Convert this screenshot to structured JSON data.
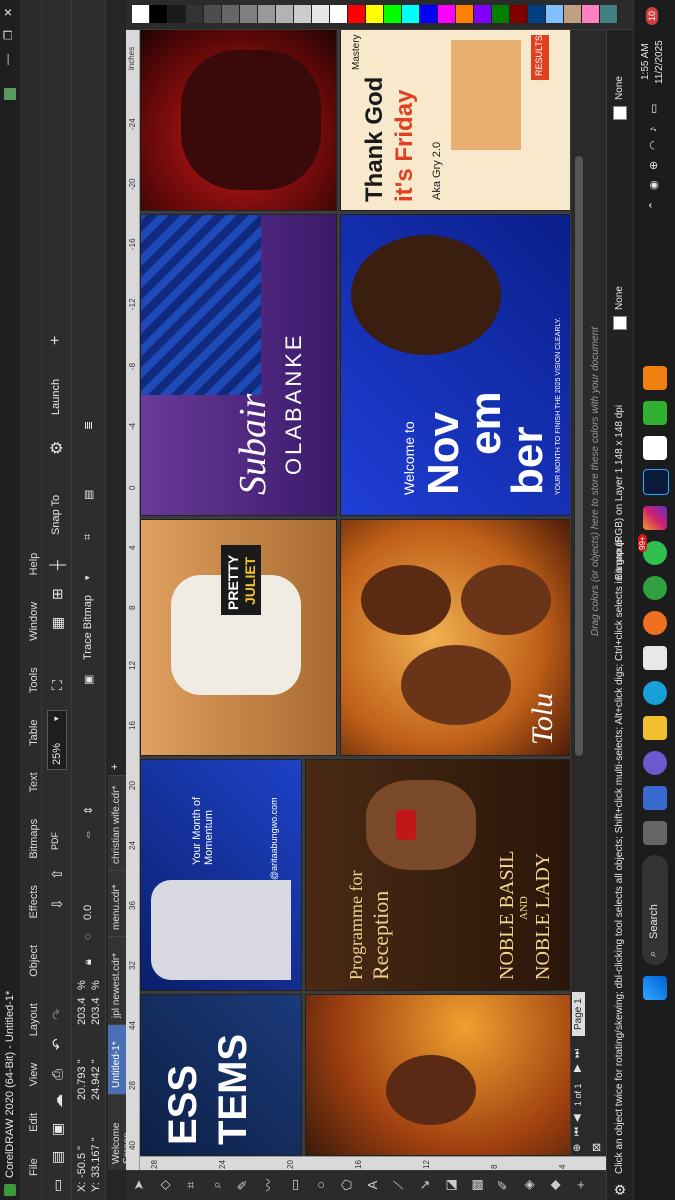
{
  "window": {
    "title": "CorelDRAW 2020 (64-Bit) - Untitled-1*"
  },
  "menu": [
    "File",
    "Edit",
    "View",
    "Layout",
    "Object",
    "Effects",
    "Bitmaps",
    "Text",
    "Table",
    "Tools",
    "Window",
    "Help"
  ],
  "toolbar": {
    "zoom": "25%",
    "snap_to": "Snap To",
    "launch": "Launch"
  },
  "properties": {
    "x": "-50.5 \"",
    "y": "33.167 \"",
    "w": "20.793 \"",
    "h": "24.942 \"",
    "sx": "203.4",
    "sy": "203.4",
    "pct": "%",
    "angle": "0.0",
    "trace": "Trace Bitmap"
  },
  "tabs": [
    "Welcome Screen",
    "Untitled-1*",
    "jpl newest.cdr*",
    "menu.cdr*",
    "christian wife.cdr*"
  ],
  "ruler": {
    "unit": "inches",
    "top_ticks": [
      "40",
      "28",
      "44",
      "32",
      "36",
      "24",
      "20",
      "16",
      "12",
      "8",
      "4",
      "0",
      "-4",
      "-8",
      "-12",
      "-16",
      "-20",
      "-24"
    ],
    "side_ticks": [
      "28",
      "24",
      "20",
      "16",
      "12",
      "8",
      "4"
    ]
  },
  "page": {
    "label": "Page 1",
    "count": "1 of 1"
  },
  "hint": "Drag colors (or objects) here to store these colors with your document",
  "status": {
    "text": "Click an object twice for rotating/skewing; dbl-clicking tool selects all objects; Shift+click multi-selects; Alt+click digs; Ctrl+click selects in a group",
    "object": "Bitmap (RGB) on Layer 1 148 x 148 dpi",
    "fill": "None",
    "outline": "None"
  },
  "posters": {
    "p1_text": [
      "ESS",
      "TEMS"
    ],
    "p2_text": [
      "Programme for",
      "Reception",
      "NOBLE BASIL",
      "AND",
      "NOBLE LADY"
    ],
    "p3_text": [
      "Your Month of Momentum",
      "@aritaabungwo.com"
    ],
    "p4_text": [
      "PRETTY",
      "JULIET"
    ],
    "p5_text": [
      "Tolu"
    ],
    "p6_text": [
      "OLABANKE",
      "Subair"
    ],
    "p7_text": [
      "Welcome to",
      "Nov",
      "em",
      "ber",
      "YOUR MONTH TO FINISH THE 2025 VISION CLEARLY."
    ],
    "p8_text": [
      "Thank God",
      "it's Friday",
      "Aka Gry 2.0",
      "Mastery",
      "RESULTS"
    ]
  },
  "taskbar": {
    "search": "Search",
    "time": "1:55 AM",
    "date": "11/2/2025",
    "badge_wa": "99+",
    "badge_notif": "10"
  },
  "colors": {
    "accent": "#4a6fb5",
    "orange": "#e8853c",
    "blue_poster": "#1f3fd6"
  },
  "palette": [
    "#ffffff",
    "#000000",
    "#1a1a1a",
    "#333333",
    "#4d4d4d",
    "#666666",
    "#808080",
    "#999999",
    "#b3b3b3",
    "#cccccc",
    "#e6e6e6",
    "#ffffff",
    "#ff0000",
    "#ffff00",
    "#00ff00",
    "#00ffff",
    "#0000ff",
    "#ff00ff",
    "#ff8000",
    "#8000ff",
    "#008000",
    "#800000",
    "#004080",
    "#80c0ff",
    "#c0a080",
    "#ff80c0",
    "#408080"
  ]
}
